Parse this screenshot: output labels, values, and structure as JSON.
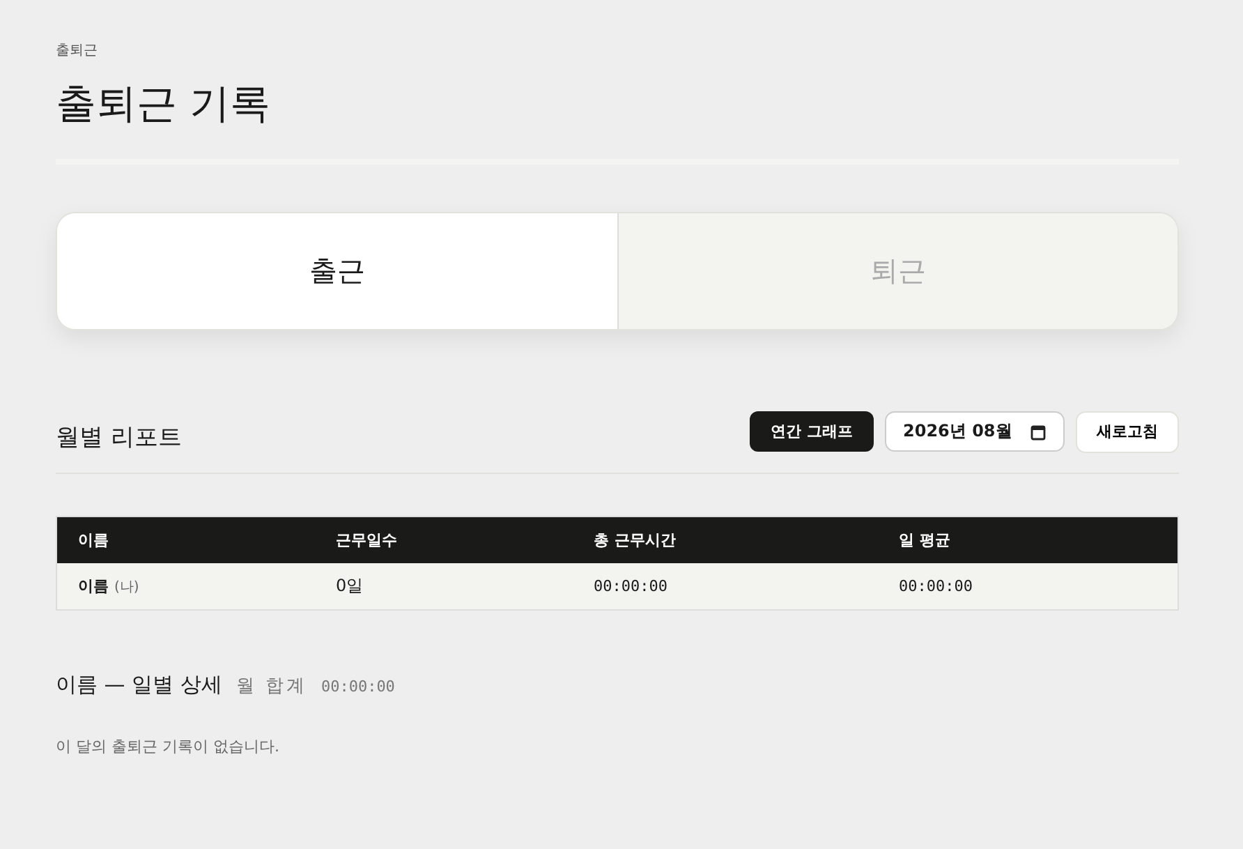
{
  "breadcrumb": "출퇴근",
  "title": "출퇴근 기록",
  "punch_tabs": [
    {
      "label": "출근",
      "selected": true
    },
    {
      "label": "퇴근",
      "selected": false
    }
  ],
  "report": {
    "title": "월별 리포트",
    "graph_button": "연간 그래프",
    "month_field": {
      "value": "2026년 08월"
    },
    "refresh_button": "새로고침"
  },
  "table": {
    "columns": [
      "이름",
      "근무일수",
      "총 근무시간",
      "일 평균"
    ],
    "rows": [
      {
        "name": "이름",
        "tag": "(나)",
        "days": "0일",
        "total": "00:00:00",
        "average": "00:00:00"
      }
    ]
  },
  "detail": {
    "title": "이름 — 일별 상세",
    "total_label": "월 합계",
    "total_value": "00:00:00",
    "empty_message": "이 달의 출퇴근 기록이 없습니다."
  }
}
